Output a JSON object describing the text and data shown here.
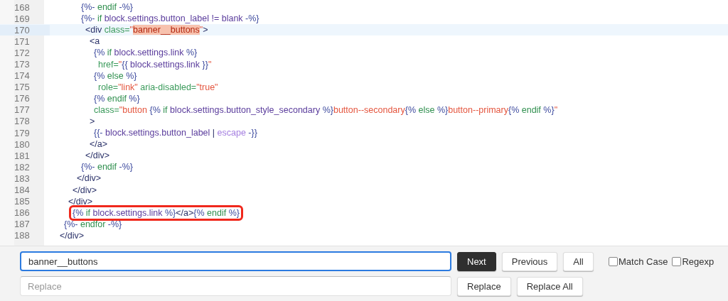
{
  "editor": {
    "lines": [
      {
        "number": "168",
        "selected": false,
        "boxed": false,
        "tokens": [
          {
            "t": "      {%-",
            "kind": "delim"
          },
          {
            "t": " endif ",
            "kind": "keyword"
          },
          {
            "t": "-%}",
            "kind": "delim"
          }
        ]
      },
      {
        "number": "169",
        "selected": false,
        "boxed": false,
        "tokens": [
          {
            "t": "      {%-",
            "kind": "delim"
          },
          {
            "t": " if ",
            "kind": "keyword"
          },
          {
            "t": "block.settings.button_label != blank ",
            "kind": "var"
          },
          {
            "t": "-%}",
            "kind": "delim"
          }
        ]
      },
      {
        "number": "170",
        "selected": true,
        "boxed": false,
        "tokens": [
          {
            "t": "       <div ",
            "kind": "tag"
          },
          {
            "t": "class=",
            "kind": "attr"
          },
          {
            "t": "\"",
            "kind": "string"
          },
          {
            "t": "banner__buttons",
            "kind": "match"
          },
          {
            "t": "\"",
            "kind": "string"
          },
          {
            "t": ">",
            "kind": "tag"
          }
        ]
      },
      {
        "number": "171",
        "selected": false,
        "boxed": false,
        "tokens": [
          {
            "t": "        <a",
            "kind": "tag"
          }
        ]
      },
      {
        "number": "172",
        "selected": false,
        "boxed": false,
        "tokens": [
          {
            "t": "         {%",
            "kind": "delim"
          },
          {
            "t": " if ",
            "kind": "keyword"
          },
          {
            "t": "block.settings.link ",
            "kind": "var"
          },
          {
            "t": "%}",
            "kind": "delim"
          }
        ]
      },
      {
        "number": "173",
        "selected": false,
        "boxed": false,
        "tokens": [
          {
            "t": "          href=",
            "kind": "attr"
          },
          {
            "t": "\"",
            "kind": "string"
          },
          {
            "t": "{{ ",
            "kind": "delim"
          },
          {
            "t": "block.settings.link ",
            "kind": "var"
          },
          {
            "t": "}}",
            "kind": "delim"
          },
          {
            "t": "\"",
            "kind": "string"
          }
        ]
      },
      {
        "number": "174",
        "selected": false,
        "boxed": false,
        "tokens": [
          {
            "t": "         {%",
            "kind": "delim"
          },
          {
            "t": " else ",
            "kind": "keyword"
          },
          {
            "t": "%}",
            "kind": "delim"
          }
        ]
      },
      {
        "number": "175",
        "selected": false,
        "boxed": false,
        "tokens": [
          {
            "t": "          role=",
            "kind": "attr"
          },
          {
            "t": "\"link\"",
            "kind": "string"
          },
          {
            "t": " aria-disabled=",
            "kind": "attr"
          },
          {
            "t": "\"true\"",
            "kind": "string"
          }
        ]
      },
      {
        "number": "176",
        "selected": false,
        "boxed": false,
        "tokens": [
          {
            "t": "         {%",
            "kind": "delim"
          },
          {
            "t": " endif ",
            "kind": "keyword"
          },
          {
            "t": "%}",
            "kind": "delim"
          }
        ]
      },
      {
        "number": "177",
        "selected": false,
        "boxed": false,
        "tokens": [
          {
            "t": "         class=",
            "kind": "attr"
          },
          {
            "t": "\"button ",
            "kind": "string"
          },
          {
            "t": "{%",
            "kind": "delim"
          },
          {
            "t": " if ",
            "kind": "keyword"
          },
          {
            "t": "block.settings.button_style_secondary ",
            "kind": "var"
          },
          {
            "t": "%}",
            "kind": "delim"
          },
          {
            "t": "button--secondary",
            "kind": "string"
          },
          {
            "t": "{%",
            "kind": "delim"
          },
          {
            "t": " else ",
            "kind": "keyword"
          },
          {
            "t": "%}",
            "kind": "delim"
          },
          {
            "t": "button--primary",
            "kind": "string"
          },
          {
            "t": "{%",
            "kind": "delim"
          },
          {
            "t": " endif ",
            "kind": "keyword"
          },
          {
            "t": "%}",
            "kind": "delim"
          },
          {
            "t": "\"",
            "kind": "string"
          }
        ]
      },
      {
        "number": "178",
        "selected": false,
        "boxed": false,
        "tokens": [
          {
            "t": "        >",
            "kind": "tag"
          }
        ]
      },
      {
        "number": "179",
        "selected": false,
        "boxed": false,
        "tokens": [
          {
            "t": "         {{-",
            "kind": "delim"
          },
          {
            "t": " block.settings.button_label ",
            "kind": "var"
          },
          {
            "t": "| ",
            "kind": "tag"
          },
          {
            "t": "escape",
            "kind": "filter"
          },
          {
            "t": " -}}",
            "kind": "delim"
          }
        ]
      },
      {
        "number": "180",
        "selected": false,
        "boxed": false,
        "tokens": [
          {
            "t": "        </a>",
            "kind": "tag"
          }
        ]
      },
      {
        "number": "181",
        "selected": false,
        "boxed": false,
        "tokens": [
          {
            "t": "       </div>",
            "kind": "tag"
          }
        ]
      },
      {
        "number": "182",
        "selected": false,
        "boxed": false,
        "tokens": [
          {
            "t": "      {%-",
            "kind": "delim"
          },
          {
            "t": " endif ",
            "kind": "keyword"
          },
          {
            "t": "-%}",
            "kind": "delim"
          }
        ]
      },
      {
        "number": "183",
        "selected": false,
        "boxed": false,
        "tokens": [
          {
            "t": "     </div>",
            "kind": "tag"
          }
        ]
      },
      {
        "number": "184",
        "selected": false,
        "boxed": false,
        "tokens": [
          {
            "t": "    </div>",
            "kind": "tag"
          }
        ]
      },
      {
        "number": "185",
        "selected": false,
        "boxed": false,
        "tokens": [
          {
            "t": "   </div>",
            "kind": "tag"
          }
        ]
      },
      {
        "number": "186",
        "selected": false,
        "boxed": true,
        "tokens": [
          {
            "t": "    {%",
            "kind": "delim"
          },
          {
            "t": " if ",
            "kind": "keyword"
          },
          {
            "t": "block.settings.link ",
            "kind": "var"
          },
          {
            "t": "%}",
            "kind": "delim"
          },
          {
            "t": "</a>",
            "kind": "tag"
          },
          {
            "t": "{%",
            "kind": "delim"
          },
          {
            "t": " endif ",
            "kind": "keyword"
          },
          {
            "t": "%}",
            "kind": "delim"
          }
        ]
      },
      {
        "number": "187",
        "selected": false,
        "boxed": false,
        "tokens": [
          {
            "t": "  {%-",
            "kind": "delim"
          },
          {
            "t": " endfor ",
            "kind": "keyword"
          },
          {
            "t": "-%}",
            "kind": "delim"
          }
        ]
      },
      {
        "number": "188",
        "selected": false,
        "boxed": false,
        "tokens": [
          {
            "t": " </div>",
            "kind": "tag"
          }
        ]
      }
    ]
  },
  "search": {
    "find_value": "banner__buttons",
    "replace_placeholder": "Replace",
    "find_buttons": [
      {
        "label": "Next",
        "primary": true
      },
      {
        "label": "Previous",
        "primary": false
      },
      {
        "label": "All",
        "primary": false
      }
    ],
    "options": [
      {
        "label": "Match Case",
        "checked": false
      },
      {
        "label": "Regexp",
        "checked": false
      }
    ],
    "replace_buttons": [
      {
        "label": "Replace"
      },
      {
        "label": "Replace All"
      }
    ]
  }
}
